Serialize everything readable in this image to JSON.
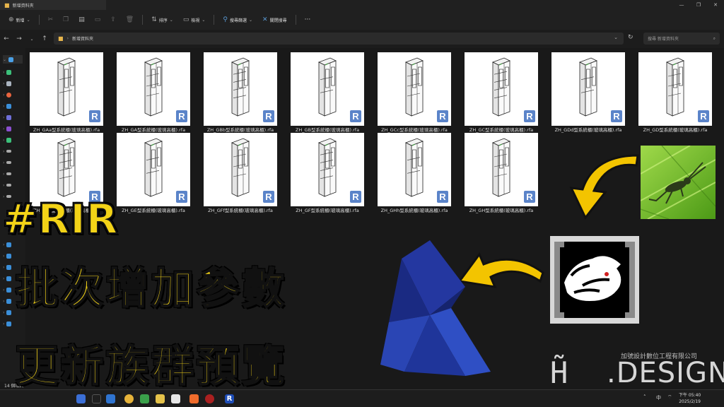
{
  "window": {
    "tab_title": "新增資料夾",
    "controls": [
      "—",
      "❐",
      "✕"
    ]
  },
  "toolbar": {
    "new_label": "新增",
    "sort_label": "排序",
    "view_label": "檢視",
    "filter_label": "搜尋篩選",
    "close_search_label": "關閉搜尋",
    "more_label": "···"
  },
  "address": {
    "path_label": "新增資料夾",
    "search_placeholder": "搜尋 新增資料夾"
  },
  "files": [
    {
      "name": "ZH_GAa型系統櫃(玻璃高櫃).rfa"
    },
    {
      "name": "ZH_GA型系統櫃(玻璃高櫃).rfa"
    },
    {
      "name": "ZH_GBb型系統櫃(玻璃高櫃).rfa"
    },
    {
      "name": "ZH_GB型系統櫃(玻璃高櫃).rfa"
    },
    {
      "name": "ZH_GCc型系統櫃(玻璃高櫃).rfa"
    },
    {
      "name": "ZH_GC型系統櫃(玻璃高櫃).rfa"
    },
    {
      "name": "ZH_GDd型系統櫃(玻璃高櫃).rfa"
    },
    {
      "name": "ZH_GD型系統櫃(玻璃高櫃).rfa"
    },
    {
      "name": "ZH_GEe型系統櫃(玻璃高櫃).rfa"
    },
    {
      "name": "ZH_GE型系統櫃(玻璃高櫃).rfa"
    },
    {
      "name": "ZH_GFf型系統櫃(玻璃高櫃).rfa"
    },
    {
      "name": "ZH_GF型系統櫃(玻璃高櫃).rfa"
    },
    {
      "name": "ZH_GHh型系統櫃(玻璃高櫃).rfa"
    },
    {
      "name": "ZH_GH型系統櫃(玻璃高櫃).rfa"
    }
  ],
  "revit_badge": "R",
  "status": {
    "count": "14 個項目"
  },
  "overlay": {
    "hashtag": "#RIR",
    "line1": "批次增加參數",
    "line2": "更新族群預覽"
  },
  "brand": {
    "company": "加號設計數位工程有限公司",
    "mark": "H̃",
    "design": ".DESIGN"
  },
  "taskbar": {
    "lang": "中",
    "time": "下午 05:40",
    "date": "2025/2/19"
  },
  "colors": {
    "accent": "#f3d317",
    "revit_blue": "#1e2f8a",
    "explorer_bg": "#191919"
  }
}
